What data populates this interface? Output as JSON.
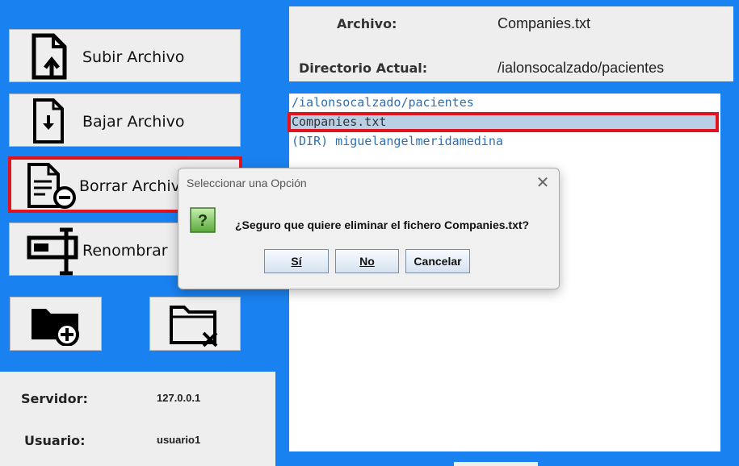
{
  "buttons": {
    "upload": "Subir Archivo",
    "download": "Bajar Archivo",
    "delete": "Borrar Archivo",
    "rename": "Renombrar",
    "new_folder_icon": "folder-plus-icon",
    "delete_folder_icon": "folder-x-icon"
  },
  "header": {
    "file_label": "Archivo:",
    "file_value": "Companies.txt",
    "dir_label": "Directorio Actual:",
    "dir_value": "/ialonsocalzado/pacientes"
  },
  "file_list": {
    "items": [
      "/ialonsocalzado/pacientes",
      "Companies.txt",
      "(DIR) miguelangelmeridamedina"
    ],
    "selected": "Companies.txt"
  },
  "server_info": {
    "server_label": "Servidor:",
    "server_value": "127.0.0.1",
    "user_label": "Usuario:",
    "user_value": "usuario1"
  },
  "dialog": {
    "title": "Seleccionar una Opción",
    "message": "¿Seguro que quiere eliminar el fichero Companies.txt?",
    "question_icon": "?",
    "yes": "Sí",
    "no": "No",
    "cancel": "Cancelar"
  },
  "colors": {
    "background": "#1a82f0",
    "highlight": "#e0141e",
    "selection": "#b8cfe5",
    "list_text": "#2f6fb0"
  }
}
